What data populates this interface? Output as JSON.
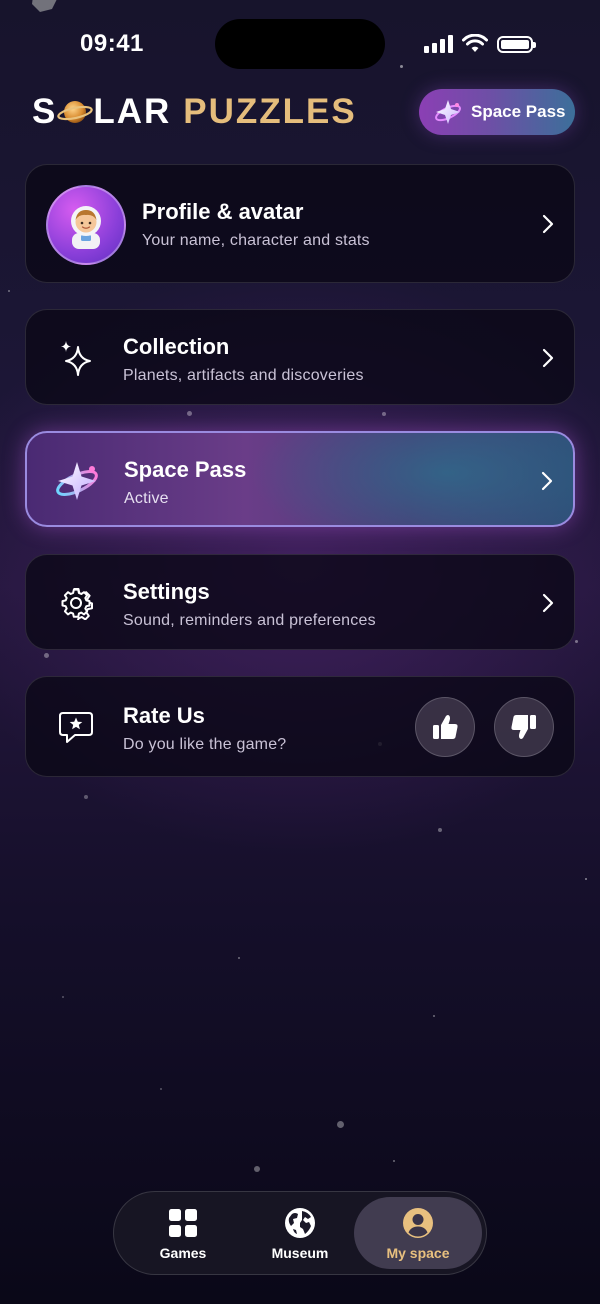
{
  "status_bar": {
    "time": "09:41"
  },
  "header": {
    "logo_word1_start": "S",
    "logo_word1_end": "LAR",
    "logo_word2": "PUZZLES",
    "space_pass_button": "Space Pass"
  },
  "menu": {
    "profile": {
      "title": "Profile & avatar",
      "subtitle": "Your name, character and stats"
    },
    "collection": {
      "title": "Collection",
      "subtitle": "Planets, artifacts and discoveries"
    },
    "space_pass": {
      "title": "Space Pass",
      "subtitle": "Active"
    },
    "settings": {
      "title": "Settings",
      "subtitle": "Sound, reminders and preferences"
    },
    "rate": {
      "title": "Rate Us",
      "subtitle": "Do you like the game?"
    }
  },
  "tabs": [
    {
      "label": "Games",
      "icon": "grid-icon"
    },
    {
      "label": "Museum",
      "icon": "globe-icon"
    },
    {
      "label": "My space",
      "icon": "person-icon",
      "selected": true
    }
  ],
  "colors": {
    "accent_gold": "#e5bd7c",
    "active_card_border": "#9a8be0",
    "background": "#17142c"
  }
}
